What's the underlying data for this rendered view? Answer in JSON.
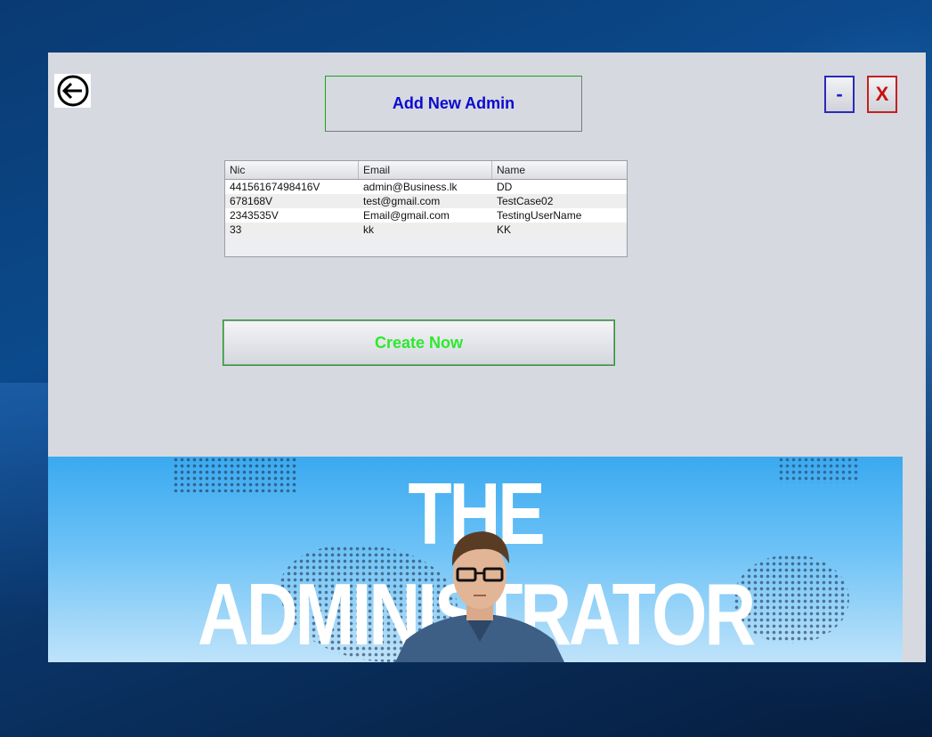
{
  "window": {
    "title": "Add New Admin",
    "minimize_label": "-",
    "close_label": "X"
  },
  "table": {
    "headers": [
      "Nic",
      "Email",
      "Name"
    ],
    "rows": [
      [
        "44156167498416V",
        "admin@Business.lk",
        "DD"
      ],
      [
        "678168V",
        "test@gmail.com",
        "TestCase02"
      ],
      [
        "2343535V",
        "Email@gmail.com",
        "TestingUserName"
      ],
      [
        "33",
        "kk",
        "KK"
      ]
    ]
  },
  "actions": {
    "create_label": "Create Now"
  },
  "banner": {
    "text": "THE ADMINISTRATOR"
  },
  "colors": {
    "title_text": "#0a0ad0",
    "create_text": "#2ee82e",
    "close_text": "#c81010",
    "minimize_text": "#1e1ec8"
  },
  "icons": {
    "back": "arrow-left-circle-icon"
  }
}
